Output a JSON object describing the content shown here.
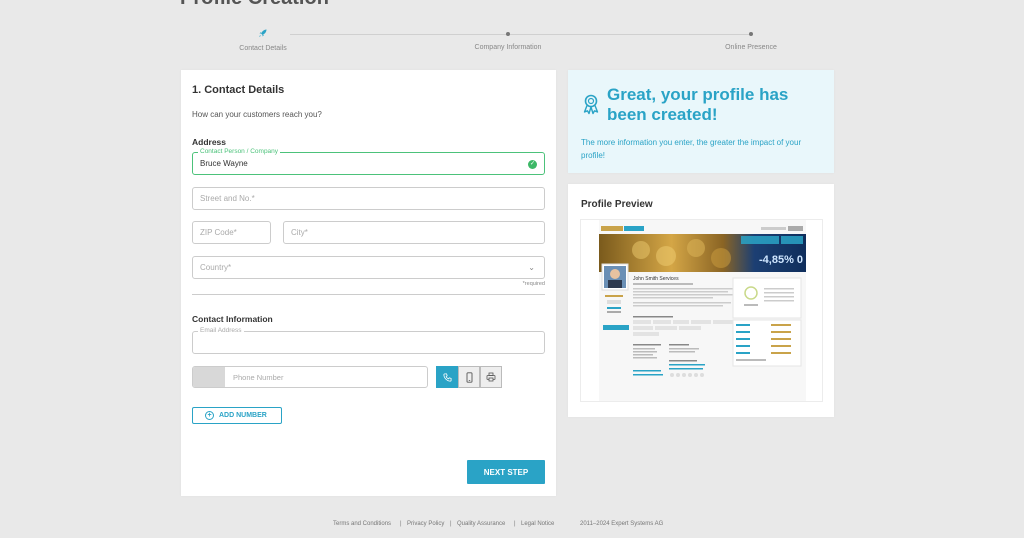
{
  "page": {
    "title": "Profile Creation"
  },
  "steps": [
    {
      "label": "Contact Details"
    },
    {
      "label": "Company Information"
    },
    {
      "label": "Online Presence"
    }
  ],
  "form": {
    "heading": "1. Contact Details",
    "subheading": "How can your customers reach you?",
    "address_label": "Address",
    "contact_person": {
      "label": "Contact Person / Company",
      "value": "Bruce  Wayne"
    },
    "street": {
      "placeholder": "Street and No.*"
    },
    "zip": {
      "placeholder": "ZIP Code*"
    },
    "city": {
      "placeholder": "City*"
    },
    "country": {
      "placeholder": "Country*"
    },
    "required_note": "*required",
    "contact_info_label": "Contact Information",
    "email": {
      "label": "Email Address",
      "value": ""
    },
    "phone": {
      "placeholder": "Phone Number"
    },
    "phone_types": [
      "phone-icon",
      "mobile-icon",
      "fax-icon"
    ],
    "add_number": "ADD NUMBER",
    "next_step": "NEXT STEP"
  },
  "success": {
    "icon": "award-icon",
    "title": "Great, your profile has been created!",
    "text": "The more information you enter, the greater the impact of your profile!"
  },
  "preview": {
    "heading": "Profile Preview",
    "company_name": "John Smith Services",
    "banner_value": "-4,85% 0"
  },
  "footer": {
    "links": [
      "Terms and Conditions",
      "Privacy Policy",
      "Quality Assurance",
      "Legal Notice"
    ],
    "separator": "|",
    "copyright": "2011–2024 Expert Systems AG"
  },
  "colors": {
    "accent": "#2aa3c6",
    "valid": "#4cc27a",
    "background": "#e9e9e9"
  }
}
